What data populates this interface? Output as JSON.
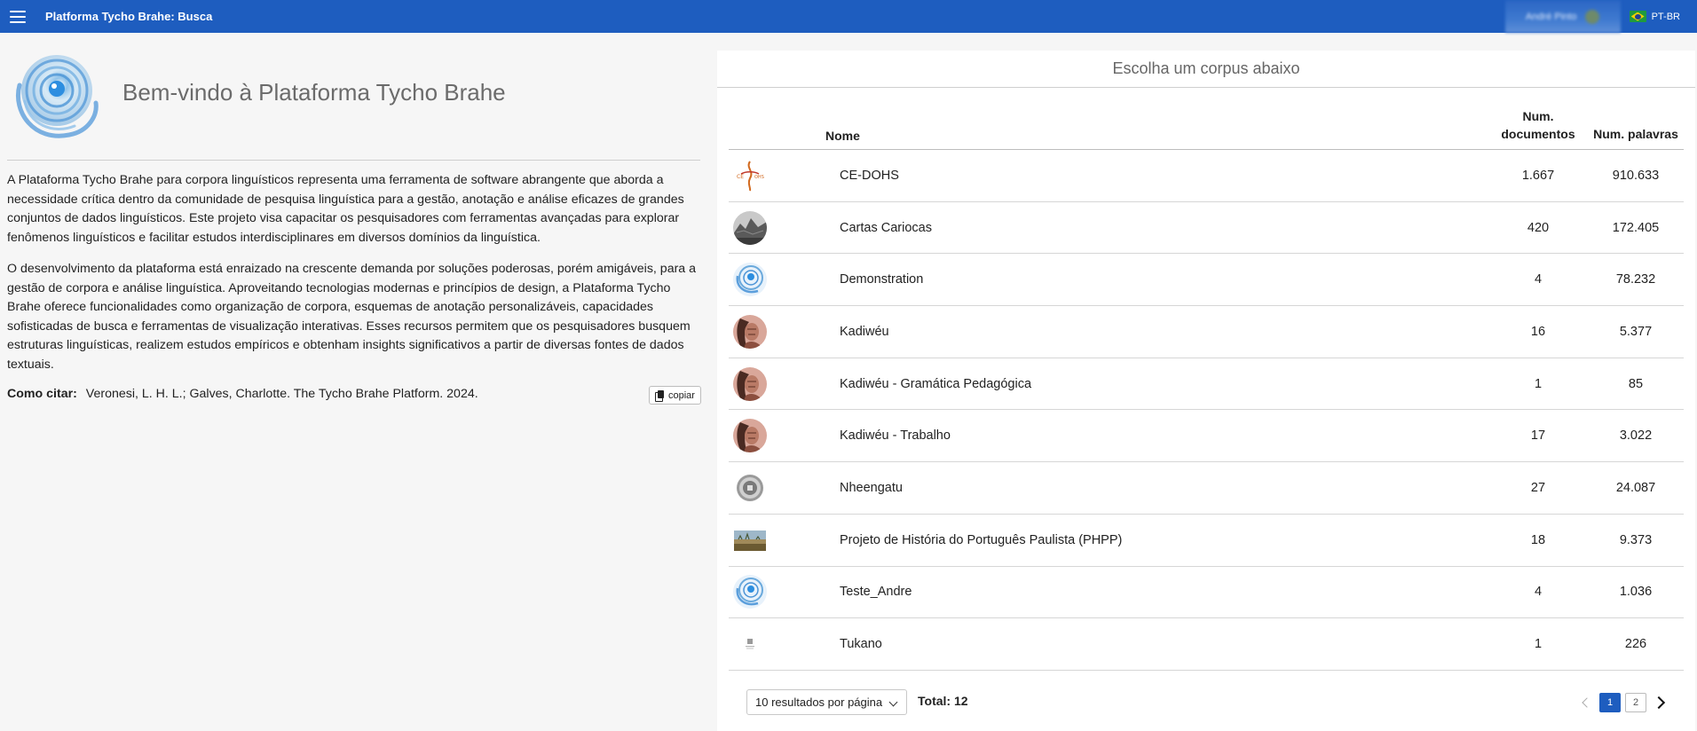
{
  "header": {
    "title": "Platforma Tycho Brahe: Busca",
    "user_name": "André Pinto",
    "language": "PT-BR"
  },
  "intro": {
    "welcome": "Bem-vindo à Plataforma Tycho Brahe",
    "paragraph1": "A Plataforma Tycho Brahe para corpora linguísticos representa uma ferramenta de software abrangente que aborda a necessidade crítica dentro da comunidade de pesquisa linguística para a gestão, anotação e análise eficazes de grandes conjuntos de dados linguísticos. Este projeto visa capacitar os pesquisadores com ferramentas avançadas para explorar fenômenos linguísticos e facilitar estudos interdisciplinares em diversos domínios da linguística.",
    "paragraph2": "O desenvolvimento da plataforma está enraizado na crescente demanda por soluções poderosas, porém amigáveis, para a gestão de corpora e análise linguística. Aproveitando tecnologias modernas e princípios de design, a Plataforma Tycho Brahe oferece funcionalidades como organização de corpora, esquemas de anotação personalizáveis, capacidades sofisticadas de busca e ferramentas de visualização interativas. Esses recursos permitem que os pesquisadores busquem estruturas linguísticas, realizem estudos empíricos e obtenham insights significativos a partir de diversas fontes de dados textuais.",
    "cite_label": "Como citar:",
    "cite_text": "Veronesi, L. H. L.; Galves, Charlotte. The Tycho Brahe Platform. 2024.",
    "copy_label": "copiar"
  },
  "corpus_panel": {
    "heading": "Escolha um corpus abaixo",
    "columns": {
      "name": "Nome",
      "docs_line1": "Num.",
      "docs_line2": "documentos",
      "words": "Num. palavras"
    },
    "rows": [
      {
        "name": "CE-DOHS",
        "docs": "1.667",
        "words": "910.633",
        "icon": "ce-dohs-logo"
      },
      {
        "name": "Cartas Cariocas",
        "docs": "420",
        "words": "172.405",
        "icon": "cartas-cariocas-photo"
      },
      {
        "name": "Demonstration",
        "docs": "4",
        "words": "78.232",
        "icon": "tycho-brahe-logo"
      },
      {
        "name": "Kadiwéu",
        "docs": "16",
        "words": "5.377",
        "icon": "kadiweu-portrait"
      },
      {
        "name": "Kadiwéu - Gramática Pedagógica",
        "docs": "1",
        "words": "85",
        "icon": "kadiweu-portrait"
      },
      {
        "name": "Kadiwéu - Trabalho",
        "docs": "17",
        "words": "3.022",
        "icon": "kadiweu-portrait"
      },
      {
        "name": "Nheengatu",
        "docs": "27",
        "words": "24.087",
        "icon": "nheengatu-seal"
      },
      {
        "name": "Projeto de História do Português Paulista (PHPP)",
        "docs": "18",
        "words": "9.373",
        "icon": "phpp-landscape"
      },
      {
        "name": "Teste_Andre",
        "docs": "4",
        "words": "1.036",
        "icon": "tycho-brahe-logo"
      },
      {
        "name": "Tukano",
        "docs": "1",
        "words": "226",
        "icon": "tukano-logo"
      }
    ],
    "per_page": "10 resultados por página",
    "total": "Total: 12",
    "pages": [
      "1",
      "2"
    ],
    "current_page": "1"
  },
  "colors": {
    "topbar": "#1e5dbf",
    "accent": "#1e5dbf"
  }
}
